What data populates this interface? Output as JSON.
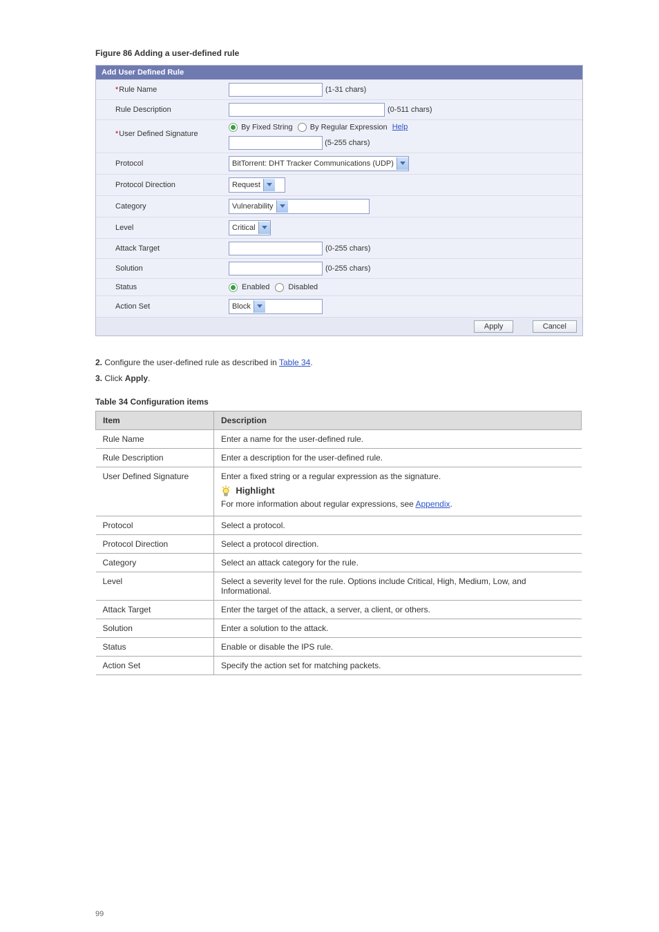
{
  "figureCaption": "Figure 86 Adding a user-defined rule",
  "panel": {
    "title": "Add User Defined Rule",
    "ruleNameLabel": "Rule Name",
    "ruleNameHint": "(1-31   chars)",
    "ruleDescLabel": "Rule Description",
    "ruleDescHint": "(0-511   chars)",
    "sigLabel": "User Defined Signature",
    "sigOpt1": "By Fixed String",
    "sigOpt2": "By Regular Expression",
    "helpLink": "Help",
    "sigHint": "(5-255   chars)",
    "protocolLabel": "Protocol",
    "protocolValue": "BitTorrent: DHT Tracker Communications (UDP)",
    "protDirLabel": "Protocol Direction",
    "protDirValue": "Request",
    "categoryLabel": "Category",
    "categoryValue": "Vulnerability",
    "levelLabel": "Level",
    "levelValue": "Critical",
    "attackTargetLabel": "Attack Target",
    "attackTargetHint": "(0-255   chars)",
    "solutionLabel": "Solution",
    "solutionHint": "(0-255   chars)",
    "statusLabel": "Status",
    "statusOpt1": "Enabled",
    "statusOpt2": "Disabled",
    "actionSetLabel": "Action Set",
    "actionSetValue": "Block",
    "applyBtn": "Apply",
    "cancelBtn": "Cancel"
  },
  "descText1": "Configure the user-defined rule as described in ",
  "descLink": "Table 34",
  "descText2": ".",
  "step3": "Click ",
  "step3b": "Apply",
  "step3c": ".",
  "tableCaption": "Table 34 Configuration items",
  "table": {
    "col1": "Item",
    "col2": "Description",
    "rows": [
      {
        "item": "Rule Name",
        "desc": "Enter a name for the user-defined rule."
      },
      {
        "item": "Rule Description",
        "desc": "Enter a description for the user-defined rule."
      },
      {
        "item": "User Defined Signature",
        "desc_pre": "Enter a fixed string or a regular expression as the signature.",
        "highlight_title": "Highlight",
        "highlight_body_pre": "For more information about regular expressions, see ",
        "highlight_link": "Appendix",
        "highlight_body_post": "."
      },
      {
        "item": "Protocol",
        "desc": "Select a protocol."
      },
      {
        "item": "Protocol Direction",
        "desc": "Select a protocol direction."
      },
      {
        "item": "Category",
        "desc": "Select an attack category for the rule."
      },
      {
        "item": "Level",
        "desc": "Select a severity level for the rule. Options include Critical, High, Medium, Low, and Informational."
      },
      {
        "item": "Attack Target",
        "desc": "Enter the target of the attack, a server, a client, or others."
      },
      {
        "item": "Solution",
        "desc": "Enter a solution to the attack."
      },
      {
        "item": "Status",
        "desc": "Enable or disable the IPS rule."
      },
      {
        "item": "Action Set",
        "desc": "Specify the action set for matching packets."
      }
    ]
  },
  "pageNum": "99"
}
